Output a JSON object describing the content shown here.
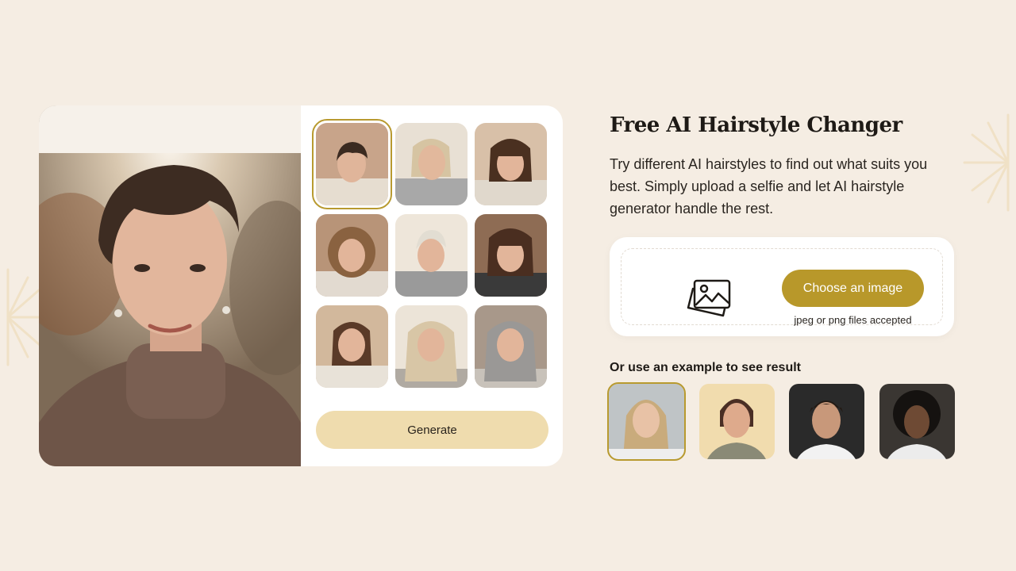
{
  "hero": {
    "title": "Free AI Hairstyle Changer",
    "description": "Try different AI hairstyles to find out what suits you best. Simply upload a selfie and let AI hairstyle generator handle the rest."
  },
  "upload": {
    "choose_label": "Choose an image",
    "accepted_text": "jpeg or png files accepted",
    "icon": "image-upload-icon"
  },
  "examples": {
    "label": "Or use an example to see result",
    "selected_index": 0
  },
  "generator": {
    "generate_label": "Generate",
    "selected_style_index": 0
  },
  "colors": {
    "background": "#f5ede3",
    "accent": "#b8982a",
    "generate_bg": "#efdcae"
  }
}
